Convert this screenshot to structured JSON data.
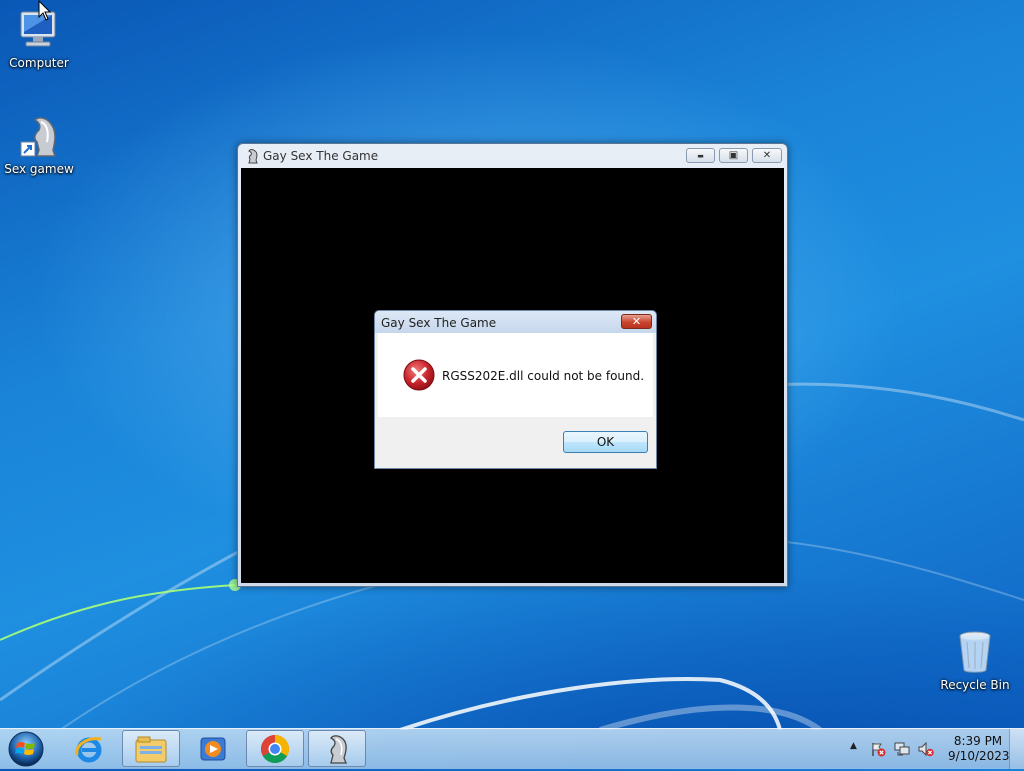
{
  "desktop": {
    "icons": [
      {
        "label": "Computer"
      },
      {
        "label": "Sex gamew"
      },
      {
        "label": "Recycle Bin"
      }
    ]
  },
  "game_window": {
    "title": "Gay Sex The Game",
    "minimize_glyph": "▬",
    "maximize_glyph": "▣",
    "close_glyph": "✕"
  },
  "dialog": {
    "title": "Gay Sex The Game",
    "close_glyph": "✕",
    "message": "RGSS202E.dll could not be found.",
    "ok_label": "OK",
    "icon": "error-icon"
  },
  "taskbar": {
    "items": [
      {
        "name": "internet-explorer-icon",
        "open": false
      },
      {
        "name": "file-explorer-icon",
        "open": true
      },
      {
        "name": "media-player-icon",
        "open": false
      },
      {
        "name": "chrome-icon",
        "open": true
      },
      {
        "name": "game-app-icon",
        "open": true
      }
    ],
    "tray": {
      "show_hidden_glyph": "▲",
      "time": "8:39 PM",
      "date": "9/10/2023"
    }
  },
  "colors": {
    "error_red": "#c8232c",
    "game_canvas": "#000000"
  }
}
